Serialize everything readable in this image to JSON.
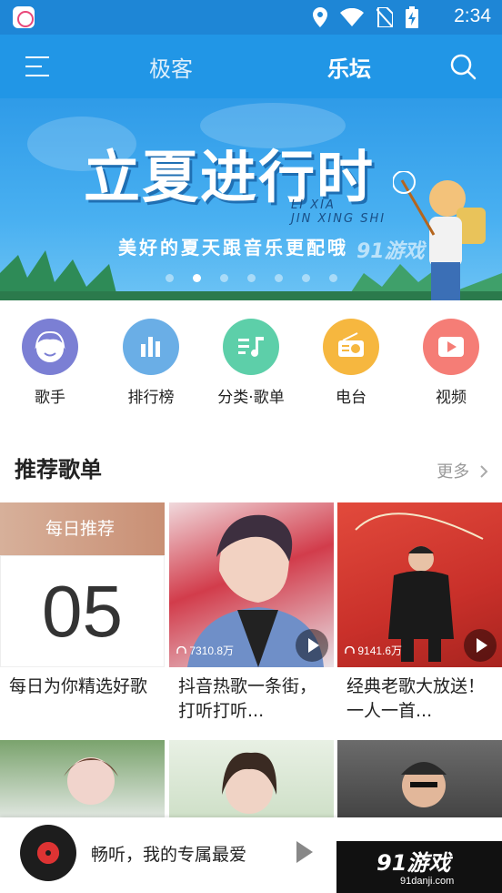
{
  "status_bar": {
    "time": "2:34"
  },
  "nav": {
    "tabs": [
      "极客",
      "乐坛"
    ],
    "active_tab": "乐坛"
  },
  "banner": {
    "title": "立夏进行时",
    "pinyin_line1": "LI XIA",
    "pinyin_line2": "JIN XING SHI",
    "subtitle": "美好的夏天跟音乐更配哦",
    "watermark": "91游戏",
    "page_count": 7,
    "active_page": 1
  },
  "categories": [
    {
      "label": "歌手",
      "icon": "singer-face-icon",
      "color": "#7b7fd4"
    },
    {
      "label": "排行榜",
      "icon": "bar-chart-icon",
      "color": "#6aaee6"
    },
    {
      "label": "分类·歌单",
      "icon": "music-list-icon",
      "color": "#5dcfa9"
    },
    {
      "label": "电台",
      "icon": "radio-icon",
      "color": "#f6b73f"
    },
    {
      "label": "视频",
      "icon": "video-play-icon",
      "color": "#f57d76"
    }
  ],
  "section": {
    "title": "推荐歌单",
    "more": "更多"
  },
  "playlists": [
    {
      "badge": "每日推荐",
      "day": "05",
      "name": "每日为你精选好歌",
      "plays": ""
    },
    {
      "name": "抖音热歌一条街，打听打听...",
      "plays": "7310.8万"
    },
    {
      "name": "经典老歌大放送！一人一首...",
      "plays": "9141.6万"
    }
  ],
  "player": {
    "text": "畅听，我的专属最爱"
  },
  "footer_watermark": {
    "big": "91游戏",
    "small": "91danji.com"
  },
  "colors": {
    "nav": "#2196e6",
    "status": "#1e86d6"
  }
}
